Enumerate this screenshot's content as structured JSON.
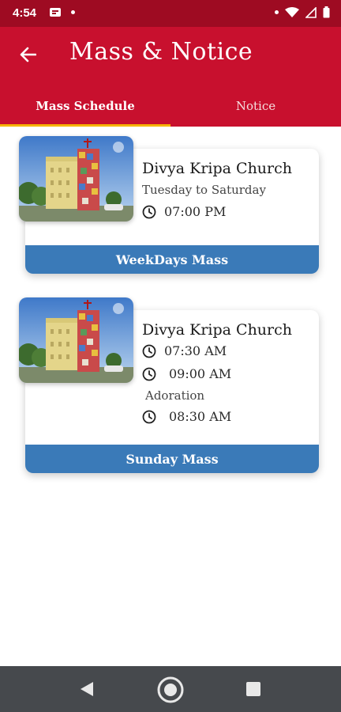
{
  "status_bar": {
    "time": "4:54"
  },
  "header": {
    "title": "Mass & Notice"
  },
  "tabs": [
    {
      "label": "Mass Schedule"
    },
    {
      "label": "Notice"
    }
  ],
  "cards": [
    {
      "church": "Divya Kripa Church",
      "days": "Tuesday to Saturday",
      "times": [
        "07:00 PM"
      ],
      "footer": "WeekDays Mass"
    },
    {
      "church": "Divya Kripa Church",
      "times": [
        "07:30 AM",
        "09:00 AM"
      ],
      "adoration_label": "Adoration",
      "adoration_time": "08:30 AM",
      "footer": "Sunday Mass"
    }
  ],
  "colors": {
    "status_bar": "#9e0b22",
    "app_bar": "#c8102e",
    "tab_indicator": "#f5b400",
    "card_footer": "#3a7ab8",
    "nav_bar": "#46494d"
  }
}
